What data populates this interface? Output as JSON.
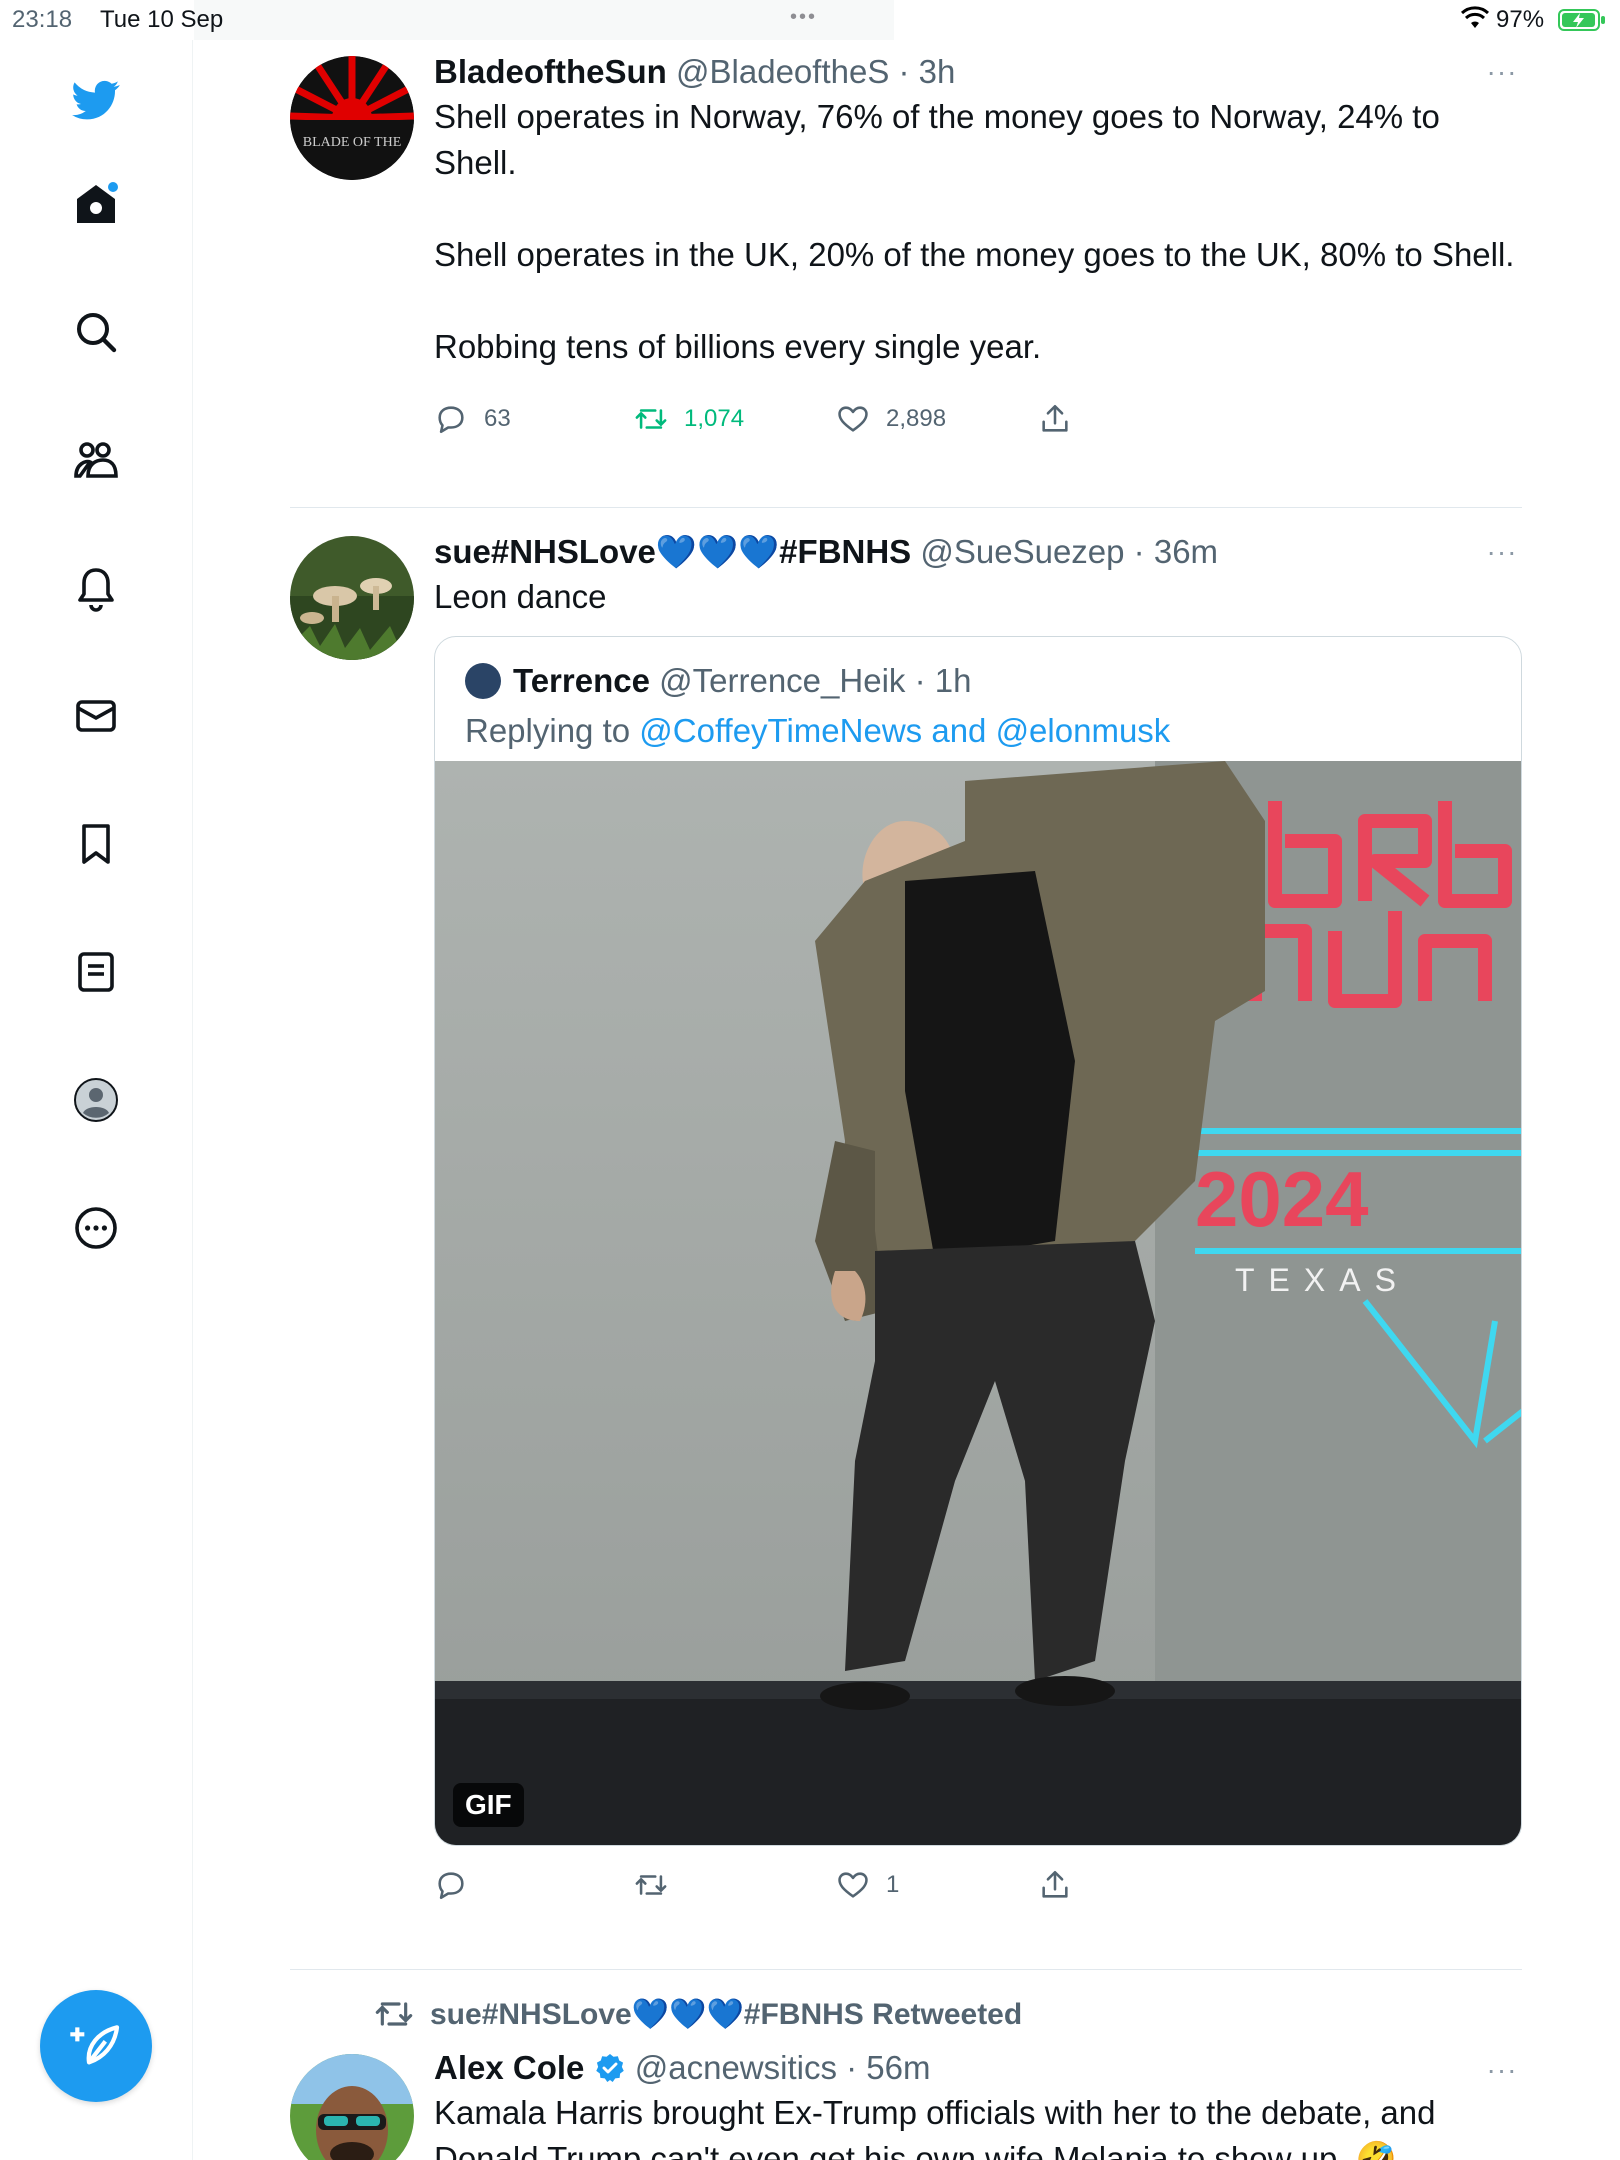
{
  "status_bar": {
    "time": "23:18",
    "date": "Tue 10 Sep",
    "dots": "•••",
    "battery_pct": "97%",
    "battery_level": 0.97
  },
  "more_glyph": "···",
  "sidebar": {
    "items": [
      {
        "icon": "twitter-logo-icon"
      },
      {
        "icon": "home-icon"
      },
      {
        "icon": "search-icon"
      },
      {
        "icon": "communities-icon"
      },
      {
        "icon": "notifications-bell-icon"
      },
      {
        "icon": "messages-envelope-icon"
      },
      {
        "icon": "bookmarks-icon"
      },
      {
        "icon": "lists-icon"
      },
      {
        "icon": "profile-avatar-icon"
      },
      {
        "icon": "more-circle-icon"
      }
    ],
    "compose_icon": "compose-feather-plus-icon"
  },
  "tweets": [
    {
      "name": "BladeoftheSun",
      "handle": "@BladeoftheS",
      "time": "3h",
      "avatar_text": "BLADE OF THE",
      "text": "Shell operates in Norway, 76% of the money goes to Norway, 24% to Shell.\n\nShell operates in the UK, 20% of the money goes to the UK, 80% to Shell.\n\nRobbing tens of billions every single year.",
      "replies": "63",
      "retweets": "1,074",
      "likes": "2,898"
    },
    {
      "name": "sue#NHSLove💙💙💙#FBNHS",
      "handle": "@SueSuezep",
      "time": "36m",
      "text": "Leon dance",
      "quote": {
        "name": "Terrence",
        "handle": "@Terrence_Heik",
        "time": "1h",
        "replying_prefix": "Replying to ",
        "replying_to": "@CoffeyTimeNews and @elonmusk",
        "media_badge": "GIF",
        "media_text_year": "2024",
        "media_text_place": "TEXAS"
      },
      "replies": "",
      "retweets": "",
      "likes": "1"
    },
    {
      "retweeted_by": "sue#NHSLove💙💙💙#FBNHS Retweeted",
      "name": "Alex Cole",
      "verified": true,
      "handle": "@acnewsitics",
      "time": "56m",
      "text": "Kamala Harris brought Ex-Trump officials with her to the debate, and Donald Trump can't even get his own wife Melania to show up. 🤣"
    }
  ]
}
